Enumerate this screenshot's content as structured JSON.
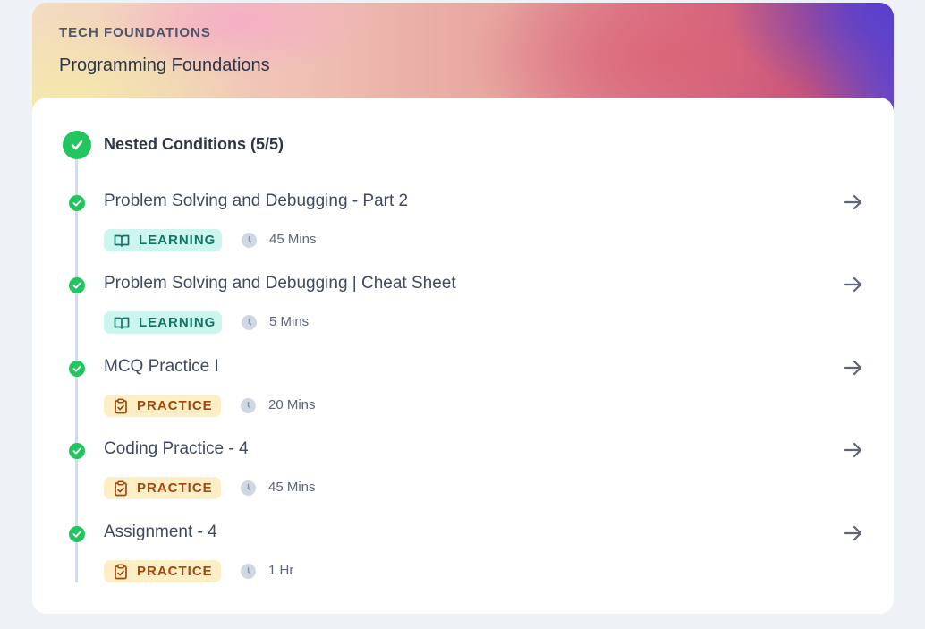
{
  "header": {
    "eyebrow": "TECH FOUNDATIONS",
    "title": "Programming Foundations"
  },
  "section": {
    "title": "Nested Conditions (5/5)",
    "status": "completed",
    "status_color": "#22c55e"
  },
  "items": [
    {
      "title": "Problem Solving and Debugging - Part 2",
      "tag": "LEARNING",
      "tag_type": "learning",
      "tag_icon": "book-icon",
      "duration": "45 Mins"
    },
    {
      "title": "Problem Solving and Debugging | Cheat Sheet",
      "tag": "LEARNING",
      "tag_type": "learning",
      "tag_icon": "book-icon",
      "duration": "5 Mins"
    },
    {
      "title": "MCQ Practice I",
      "tag": "PRACTICE",
      "tag_type": "practice",
      "tag_icon": "clipboard-check-icon",
      "duration": "20 Mins"
    },
    {
      "title": "Coding Practice - 4",
      "tag": "PRACTICE",
      "tag_type": "practice",
      "tag_icon": "clipboard-check-icon",
      "duration": "45 Mins"
    },
    {
      "title": "Assignment - 4",
      "tag": "PRACTICE",
      "tag_type": "practice",
      "tag_icon": "clipboard-check-icon",
      "duration": "1 Hr"
    }
  ],
  "colors": {
    "learning_bg": "#ccf5ef",
    "learning_text": "#0f7565",
    "practice_bg": "#fdefc5",
    "practice_text": "#a2470e"
  }
}
